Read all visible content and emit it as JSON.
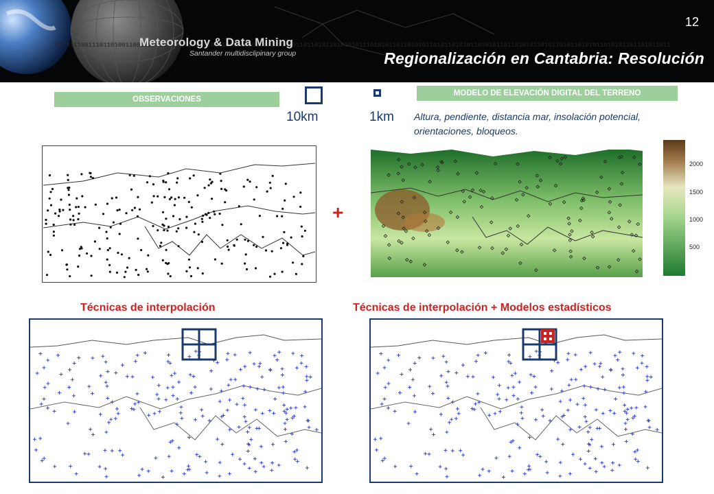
{
  "header": {
    "brand": "Meteorology & Data Mining",
    "brand_sub": "Santander multidisclipinary group",
    "page_number": "12",
    "title": "Regionalización en Cantabria: Resolución"
  },
  "observations": {
    "label": "OBSERVACIONES"
  },
  "dem": {
    "label": "MODELO DE ELEVACIÓN DIGITAL DEL TERRENO",
    "variables": "Altura, pendiente, distancia mar, insolación potencial, orientaciones, bloqueos.",
    "colorbar_ticks": [
      "2000",
      "1500",
      "1000",
      "500"
    ]
  },
  "scales": {
    "coarse": "10km",
    "fine": "1km"
  },
  "operator": "+",
  "bottom": {
    "left_title": "Técnicas de interpolación",
    "right_title": "Técnicas de interpolación + Modelos estadísticos"
  },
  "colors": {
    "accent_red": "#cc2222",
    "navy": "#1a3a6b",
    "label_green": "#9ccf9c",
    "station_blue": "#3344cc"
  }
}
